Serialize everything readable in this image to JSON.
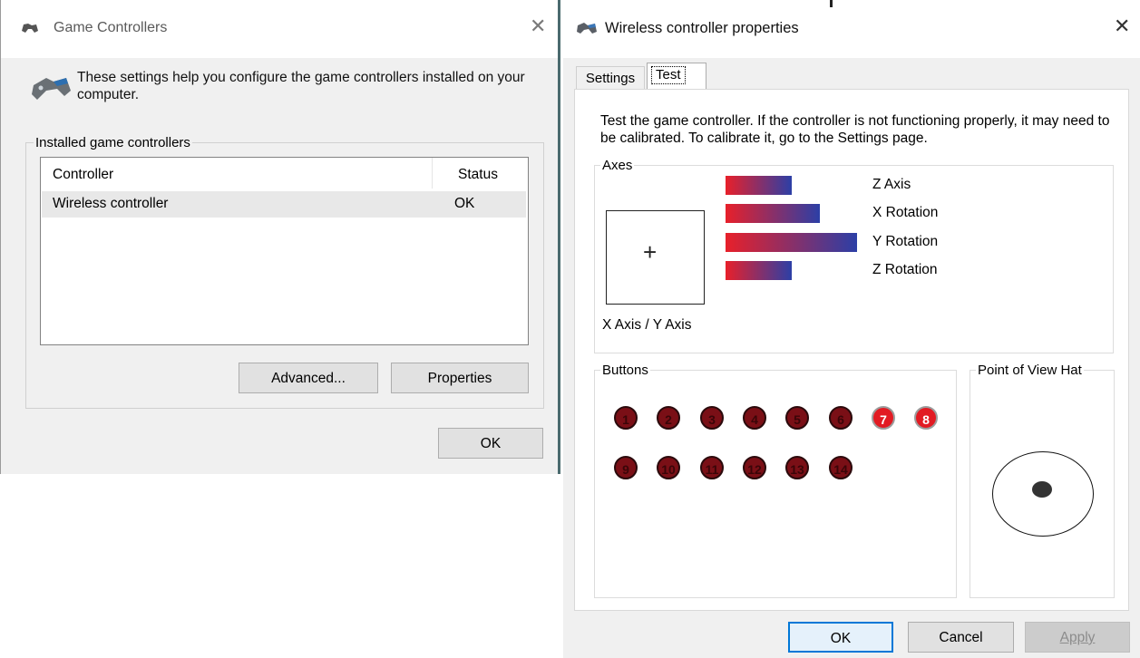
{
  "game_controllers": {
    "title": "Game Controllers",
    "intro": "These settings help you configure the game controllers installed on your computer.",
    "group_label": "Installed game controllers",
    "columns": [
      "Controller",
      "Status"
    ],
    "rows": [
      {
        "controller": "Wireless controller",
        "status": "OK"
      }
    ],
    "buttons": {
      "advanced": "Advanced...",
      "properties": "Properties",
      "ok": "OK"
    }
  },
  "properties": {
    "title": "Wireless controller properties",
    "tabs": {
      "settings": "Settings",
      "test": "Test",
      "active": "Test"
    },
    "description": "Test the game controller.  If the controller is not functioning properly, it may need to be calibrated.  To calibrate it, go to the Settings page.",
    "axes": {
      "label": "Axes",
      "xy_label": "X Axis / Y Axis",
      "bars": [
        {
          "name": "Z Axis",
          "level": 0.5
        },
        {
          "name": "X Rotation",
          "level": 0.72
        },
        {
          "name": "Y Rotation",
          "level": 1.0
        },
        {
          "name": "Z Rotation",
          "level": 0.5
        }
      ]
    },
    "buttons_group": {
      "label": "Buttons",
      "buttons": [
        {
          "n": "1",
          "pressed": false
        },
        {
          "n": "2",
          "pressed": false
        },
        {
          "n": "3",
          "pressed": false
        },
        {
          "n": "4",
          "pressed": false
        },
        {
          "n": "5",
          "pressed": false
        },
        {
          "n": "6",
          "pressed": false
        },
        {
          "n": "7",
          "pressed": true
        },
        {
          "n": "8",
          "pressed": true
        },
        {
          "n": "9",
          "pressed": false
        },
        {
          "n": "10",
          "pressed": false
        },
        {
          "n": "11",
          "pressed": false
        },
        {
          "n": "12",
          "pressed": false
        },
        {
          "n": "13",
          "pressed": false
        },
        {
          "n": "14",
          "pressed": false
        }
      ]
    },
    "pov_label": "Point of View Hat",
    "footer": {
      "ok": "OK",
      "cancel": "Cancel",
      "apply": "Apply"
    }
  },
  "colors": {
    "bar_start": "#e8202a",
    "bar_end": "#2c3fa6",
    "button_off": "#7a0f16",
    "button_on": "#e21b23",
    "ok_border": "#0078d7"
  },
  "icons": [
    "gamepad-icon",
    "close-icon"
  ]
}
